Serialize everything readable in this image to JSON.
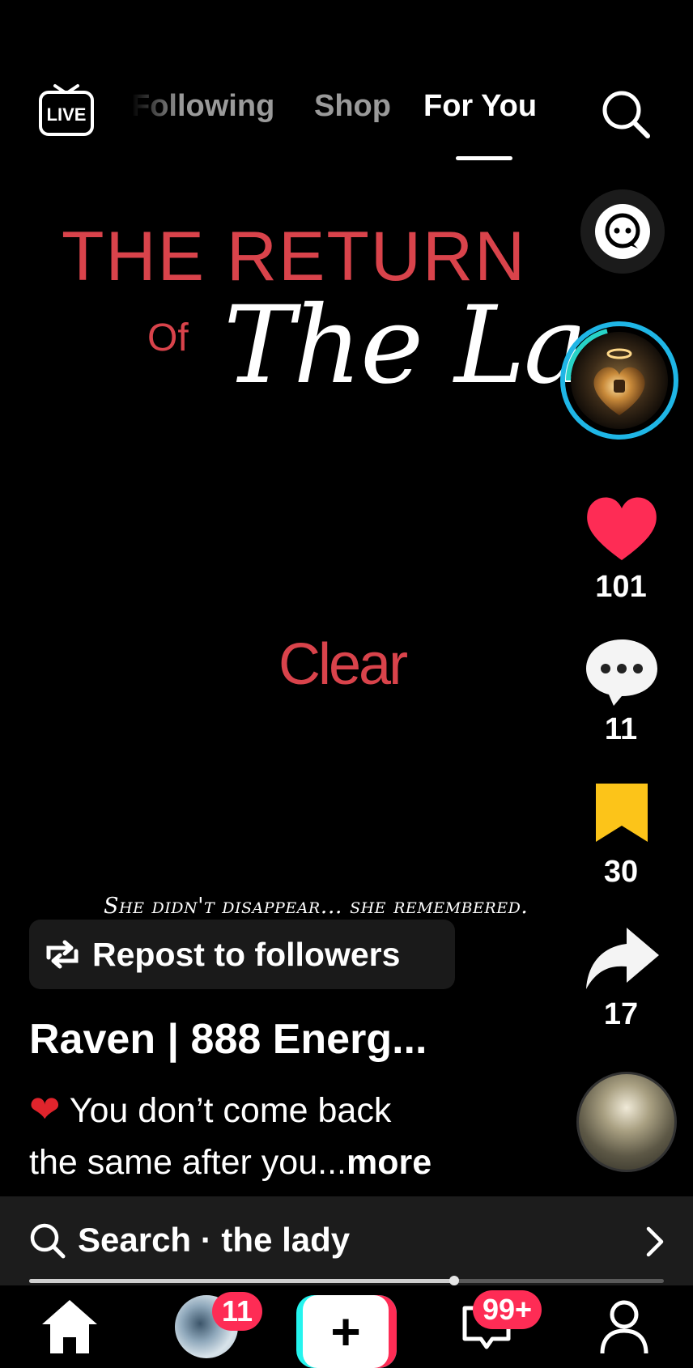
{
  "top_nav": {
    "live_label": "LIVE",
    "tabs": [
      {
        "label": "Following",
        "active": false
      },
      {
        "label": "Shop",
        "active": false
      },
      {
        "label": "For You",
        "active": true
      }
    ],
    "search_icon": "search-icon"
  },
  "video": {
    "title_line1": "THE RETURN",
    "title_of": "Of",
    "title_script": "The Lady",
    "center_text": "Clear",
    "caption": "She didn't disappear... she remembered."
  },
  "actions": {
    "like_count": "101",
    "comment_count": "11",
    "bookmark_count": "30",
    "share_count": "17"
  },
  "post": {
    "repost_label": "Repost to followers",
    "username": "Raven | 888 Energ...",
    "description_line1": "You don’t come back",
    "description_line2": "the same after you...",
    "more_label": "more"
  },
  "search_bar": {
    "label": "Search",
    "separator": " · ",
    "query": "the lady"
  },
  "playback": {
    "progress_fraction": 0.67
  },
  "bottom_nav": {
    "friends_badge": "11",
    "inbox_badge": "99+"
  },
  "colors": {
    "accent_red": "#fe2c55",
    "title_red": "#d9434b",
    "bookmark_yellow": "#fcc419",
    "avatar_ring": "#1fb6e6"
  }
}
